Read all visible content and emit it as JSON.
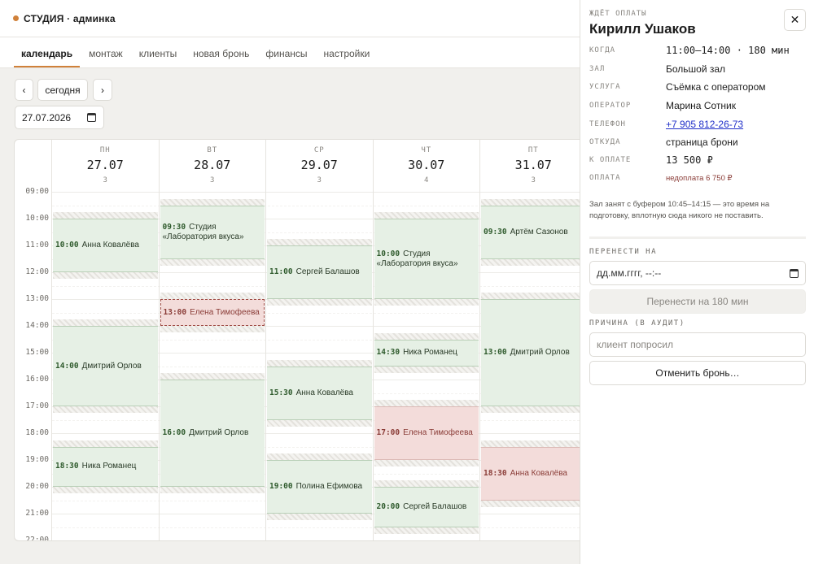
{
  "app": {
    "title": "СТУДИЯ · админка",
    "accent": "#d0813a"
  },
  "nav": {
    "tabs": [
      {
        "label": "календарь",
        "active": true
      },
      {
        "label": "монтаж"
      },
      {
        "label": "клиенты"
      },
      {
        "label": "новая бронь"
      },
      {
        "label": "финансы"
      },
      {
        "label": "настройки"
      }
    ]
  },
  "controls": {
    "prev": "‹",
    "today": "сегодня",
    "next": "›",
    "date": "27.07.2026"
  },
  "hours": [
    "09:00",
    "10:00",
    "11:00",
    "12:00",
    "13:00",
    "14:00",
    "15:00",
    "16:00",
    "17:00",
    "18:00",
    "19:00",
    "20:00",
    "21:00",
    "22:00"
  ],
  "days": [
    {
      "dow": "ПН",
      "date": "27.07",
      "count": "3",
      "bookings": [
        {
          "time": "10:00",
          "name": "Анна Ковалёва",
          "start": 10,
          "end": 12,
          "status": "paid"
        },
        {
          "time": "14:00",
          "name": "Дмитрий Орлов",
          "start": 14,
          "end": 17,
          "status": "paid"
        },
        {
          "time": "18:30",
          "name": "Ника Романец",
          "start": 18.5,
          "end": 20,
          "status": "paid"
        }
      ]
    },
    {
      "dow": "ВТ",
      "date": "28.07",
      "count": "3",
      "bookings": [
        {
          "time": "09:30",
          "name": "Студия «Лаборатория вкуса»",
          "start": 9.5,
          "end": 11.5,
          "status": "paid"
        },
        {
          "time": "13:00",
          "name": "Елена Тимофеева",
          "start": 13,
          "end": 14,
          "status": "selected"
        },
        {
          "time": "16:00",
          "name": "Дмитрий Орлов",
          "start": 16,
          "end": 20,
          "status": "paid"
        }
      ]
    },
    {
      "dow": "СР",
      "date": "29.07",
      "count": "3",
      "bookings": [
        {
          "time": "11:00",
          "name": "Сергей Балашов",
          "start": 11,
          "end": 13,
          "status": "paid"
        },
        {
          "time": "15:30",
          "name": "Анна Ковалёва",
          "start": 15.5,
          "end": 17.5,
          "status": "paid"
        },
        {
          "time": "19:00",
          "name": "Полина Ефимова",
          "start": 19,
          "end": 21,
          "status": "paid"
        }
      ]
    },
    {
      "dow": "ЧТ",
      "date": "30.07",
      "count": "4",
      "bookings": [
        {
          "time": "10:00",
          "name": "Студия «Лаборатория вкуса»",
          "start": 10,
          "end": 13,
          "status": "paid"
        },
        {
          "time": "14:30",
          "name": "Ника Романец",
          "start": 14.5,
          "end": 15.5,
          "status": "paid"
        },
        {
          "time": "17:00",
          "name": "Елена Тимофеева",
          "start": 17,
          "end": 19,
          "status": "unpaid"
        },
        {
          "time": "20:00",
          "name": "Сергей Балашов",
          "start": 20,
          "end": 21.5,
          "status": "paid"
        }
      ]
    },
    {
      "dow": "ПТ",
      "date": "31.07",
      "count": "3",
      "bookings": [
        {
          "time": "09:30",
          "name": "Артём Сазонов",
          "start": 9.5,
          "end": 11.5,
          "status": "paid"
        },
        {
          "time": "13:00",
          "name": "Дмитрий Орлов",
          "start": 13,
          "end": 17,
          "status": "paid"
        },
        {
          "time": "18:30",
          "name": "Анна Ковалёва",
          "start": 18.5,
          "end": 20.5,
          "status": "unpaid"
        }
      ]
    }
  ],
  "panel": {
    "status": "ЖДЁТ ОПЛАТЫ",
    "client": "Кирилл Ушаков",
    "close": "✕",
    "rows": [
      {
        "label": "КОГДА",
        "value": "11:00–14:00 · 180 мин",
        "style": "mono"
      },
      {
        "label": "ЗАЛ",
        "value": "Большой зал"
      },
      {
        "label": "УСЛУГА",
        "value": "Съёмка с оператором"
      },
      {
        "label": "ОПЕРАТОР",
        "value": "Марина Сотник"
      },
      {
        "label": "ТЕЛЕФОН",
        "value": "+7 905 812-26-73",
        "style": "link"
      },
      {
        "label": "ОТКУДА",
        "value": "страница брони"
      },
      {
        "label": "К ОПЛАТЕ",
        "value": "13 500 ₽",
        "style": "mono"
      },
      {
        "label": "ОПЛАТА",
        "value": "недоплата 6 750 ₽",
        "style": "warn"
      }
    ],
    "note": "Зал занят с буфером 10:45–14:15 — это время на подготовку, вплотную сюда никого не поставить.",
    "move_label": "ПЕРЕНЕСТИ НА",
    "move_placeholder": "дд.мм.гггг, --:--",
    "move_button": "Перенести на 180 мин",
    "reason_label": "ПРИЧИНА (В АУДИТ)",
    "reason_placeholder": "клиент попросил",
    "cancel_button": "Отменить бронь…"
  }
}
